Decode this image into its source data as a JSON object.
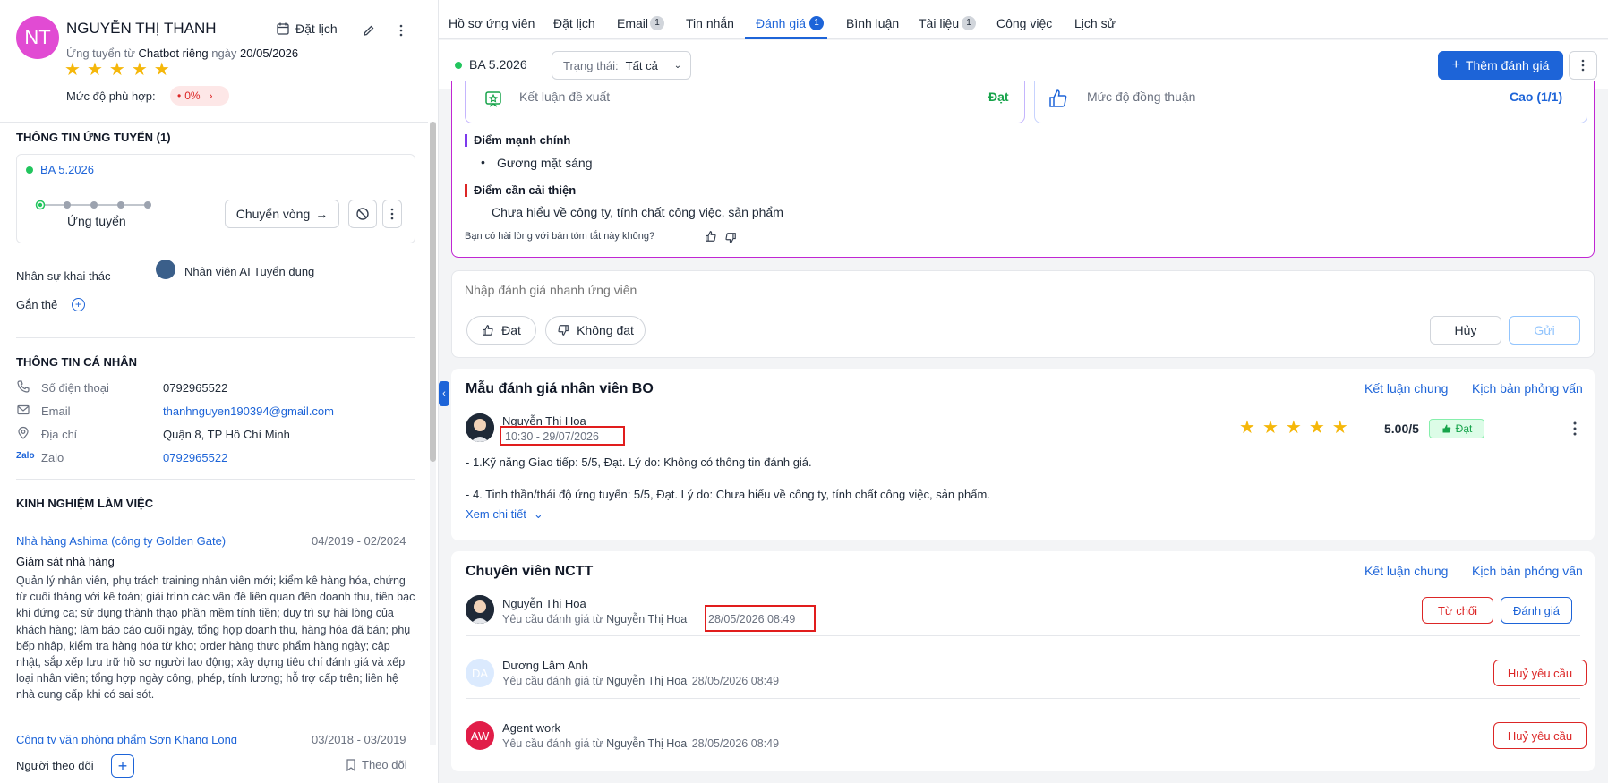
{
  "candidate": {
    "initials": "NT",
    "name": "NGUYỄN THỊ THANH",
    "applied_prefix": "Ứng tuyển từ",
    "applied_source": "Chatbot riêng",
    "applied_day_label": "ngày",
    "applied_date": "20/05/2026",
    "stars": 5,
    "fit_label": "Mức độ phù hợp:",
    "fit_value": "0%",
    "schedule_label": "Đặt lịch"
  },
  "application": {
    "title": "THÔNG TIN ỨNG TUYỂN (1)",
    "job": "BA 5.2026",
    "stage": "Ứng tuyển",
    "move_label": "Chuyển vòng",
    "owner_label": "Nhân sự khai thác",
    "owner_name": "Nhân viên AI Tuyển dụng",
    "tag_label": "Gắn thẻ"
  },
  "personal": {
    "title": "THÔNG TIN CÁ NHÂN",
    "rows": [
      {
        "label": "Số điện thoại",
        "value": "0792965522"
      },
      {
        "label": "Email",
        "value": "thanhnguyen190394@gmail.com"
      },
      {
        "label": "Địa chỉ",
        "value": "Quận 8, TP Hồ Chí Minh"
      },
      {
        "label": "Zalo",
        "value": "0792965522"
      }
    ]
  },
  "experience": {
    "title": "KINH NGHIỆM LÀM VIỆC",
    "items": [
      {
        "company": "Nhà hàng Ashima (công ty Golden Gate)",
        "period": "04/2019 - 02/2024",
        "role": "Giám sát nhà hàng",
        "desc": "Quản lý nhân viên, phụ trách training nhân viên mới; kiểm kê hàng hóa, chứng từ cuối tháng với kế toán; giải trình các vấn đề liên quan đến doanh thu, tiền bạc khi đứng ca; sử dụng thành thạo phần mềm tính tiền; duy trì sự hài lòng của khách hàng; làm báo cáo cuối ngày, tổng hợp doanh thu, hàng hóa đã bán; phụ bếp nhập, kiểm tra hàng hóa từ kho; order hàng thực phẩm hàng ngày; cập nhật, sắp xếp lưu trữ hồ sơ người lao động; xây dựng tiêu chí đánh giá và xếp loại nhân viên; tổng hợp ngày công, phép, tính lương; hỗ trợ cấp trên; liên hệ nhà cung cấp khi có sai sót."
      },
      {
        "company": "Công ty văn phòng phẩm Sơn Khang Long",
        "period": "03/2018 - 03/2019"
      }
    ]
  },
  "footer": {
    "followers_label": "Người theo dõi",
    "follow_label": "Theo dõi"
  },
  "tabs": [
    {
      "label": "Hồ sơ ứng viên"
    },
    {
      "label": "Đặt lịch"
    },
    {
      "label": "Email",
      "badge": "1"
    },
    {
      "label": "Tin nhắn"
    },
    {
      "label": "Đánh giá",
      "badge": "1"
    },
    {
      "label": "Bình luận"
    },
    {
      "label": "Tài liệu",
      "badge": "1"
    },
    {
      "label": "Công việc"
    },
    {
      "label": "Lịch sử"
    }
  ],
  "toolbar": {
    "job": "BA 5.2026",
    "status_label": "Trạng thái:",
    "status_value": "Tất cả",
    "add_label": "Thêm đánh giá"
  },
  "summary": {
    "conclusion_label": "Kết luận đề xuất",
    "conclusion_value": "Đạt",
    "consensus_label": "Mức độ đồng thuận",
    "consensus_value": "Cao (1/1)",
    "strengths_title": "Điểm mạnh chính",
    "strength_item": "Gương mặt sáng",
    "improve_title": "Điểm cần cải thiện",
    "improve_text": "Chưa hiểu về công ty, tính chất công việc, sản phẩm",
    "feedback_q": "Bạn có hài lòng với bản tóm tắt này không?"
  },
  "quick": {
    "placeholder": "Nhập đánh giá nhanh ứng viên",
    "pass": "Đạt",
    "fail": "Không đạt",
    "cancel": "Hủy",
    "send": "Gửi"
  },
  "template_card": {
    "title": "Mẫu đánh giá nhân viên BO",
    "link1": "Kết luận chung",
    "link2": "Kịch bản phỏng vấn",
    "reviewer": "Nguyễn Thị Hoa",
    "time": "10:30 - 29/07/2026",
    "score": "5.00/5",
    "result": "Đạt",
    "line1": "- 1.Kỹ năng Giao tiếp: 5/5, Đạt. Lý do: Không có thông tin đánh giá.",
    "line2": "- 4. Tinh thần/thái độ ứng tuyển: 5/5, Đạt. Lý do: Chưa hiểu về công ty, tính chất công việc, sản phẩm.",
    "detail_link": "Xem chi tiết"
  },
  "ncct_card": {
    "title": "Chuyên viên NCTT",
    "link1": "Kết luận chung",
    "link2": "Kịch bản phỏng vấn",
    "request_prefix": "Yêu cầu đánh giá từ",
    "requester": "Nguyễn Thị Hoa",
    "rows": [
      {
        "initials": "",
        "name": "Nguyễn Thị Hoa",
        "time": "28/05/2026 08:49",
        "btn1": "Từ chối",
        "btn2": "Đánh giá"
      },
      {
        "initials": "DA",
        "name": "Dương Lâm Anh",
        "time": "28/05/2026 08:49",
        "btn1": "Huỷ yêu cầu"
      },
      {
        "initials": "AW",
        "name": "Agent work",
        "time": "28/05/2026 08:49",
        "btn1": "Huỷ yêu cầu"
      }
    ]
  },
  "colors": {
    "primary": "#1d64d8",
    "avatar_pink": "#e14bd3",
    "success": "#16a34a",
    "danger": "#dc2626",
    "highlight_box": "#e11d1d"
  }
}
